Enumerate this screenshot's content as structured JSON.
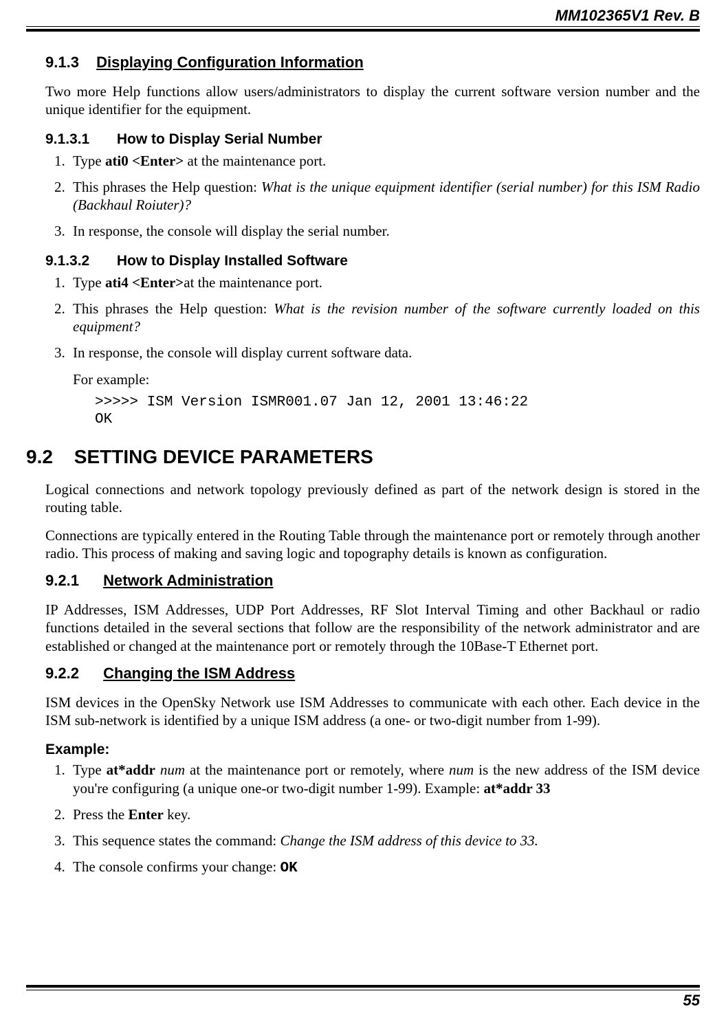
{
  "header": {
    "doc_id": "MM102365V1 Rev. B"
  },
  "footer": {
    "page_num": "55"
  },
  "s913": {
    "num": "9.1.3",
    "title": "Displaying Configuration Information",
    "intro": "Two more Help functions allow users/administrators to display the current software version number and the unique identifier for the equipment."
  },
  "s9131": {
    "num": "9.1.3.1",
    "title": "How to Display Serial Number",
    "step1_a": "Type ",
    "step1_cmd": "ati0 <Enter>",
    "step1_b": " at the maintenance port.",
    "step2_a": "This phrases the Help question: ",
    "step2_q": "What is the unique equipment identifier (serial number) for this ISM Radio (Backhaul Roiuter)?",
    "step3": "In response, the console will display the serial number."
  },
  "s9132": {
    "num": "9.1.3.2",
    "title": "How to Display Installed Software",
    "step1_a": "Type ",
    "step1_cmd": "ati4 <Enter>",
    "step1_b": "at the maintenance port.",
    "step2_a": "This phrases the Help question: ",
    "step2_q": "What is the revision number of the software currently loaded on this equipment?",
    "step3": "In response, the console will display current software data.",
    "for_example": "For example:",
    "code": ">>>>> ISM Version ISMR001.07 Jan 12, 2001 13:46:22\nOK"
  },
  "s92": {
    "num": "9.2",
    "title": "SETTING DEVICE PARAMETERS",
    "p1": "Logical connections and network topology previously defined as part of the network design is stored in the routing table.",
    "p2": "Connections are typically entered in the Routing Table through the maintenance port or remotely through another radio. This process of making and saving logic and topography details is known as configuration."
  },
  "s921": {
    "num": "9.2.1",
    "title": "Network Administration",
    "p": "IP Addresses, ISM Addresses, UDP Port Addresses, RF Slot Interval Timing and other Backhaul or radio functions detailed in the several sections that follow are the responsibility of the network administrator and are established or changed at the maintenance port or remotely through the 10Base-T Ethernet port."
  },
  "s922": {
    "num": "9.2.2",
    "title": "Changing the ISM Address",
    "p": "ISM devices in the OpenSky Network use ISM Addresses to communicate with each other. Each device in the ISM sub-network is identified by a unique ISM address (a one- or two-digit number from 1-99).",
    "example_label": "Example:",
    "step1_a": "Type ",
    "step1_cmd": "at*addr",
    "step1_b": " ",
    "step1_num": "num",
    "step1_c": " at the maintenance port or remotely, where ",
    "step1_num2": "num",
    "step1_d": " is the new address of the ISM device you're configuring (a unique one-or two-digit number 1-99). Example: ",
    "step1_ex": "at*addr 33",
    "step2_a": "Press the ",
    "step2_key": "Enter",
    "step2_b": " key.",
    "step3_a": "This sequence states the command: ",
    "step3_cmd": "Change the ISM address of this device to 33.",
    "step4_a": "The console confirms your change: ",
    "step4_ok": "OK"
  }
}
